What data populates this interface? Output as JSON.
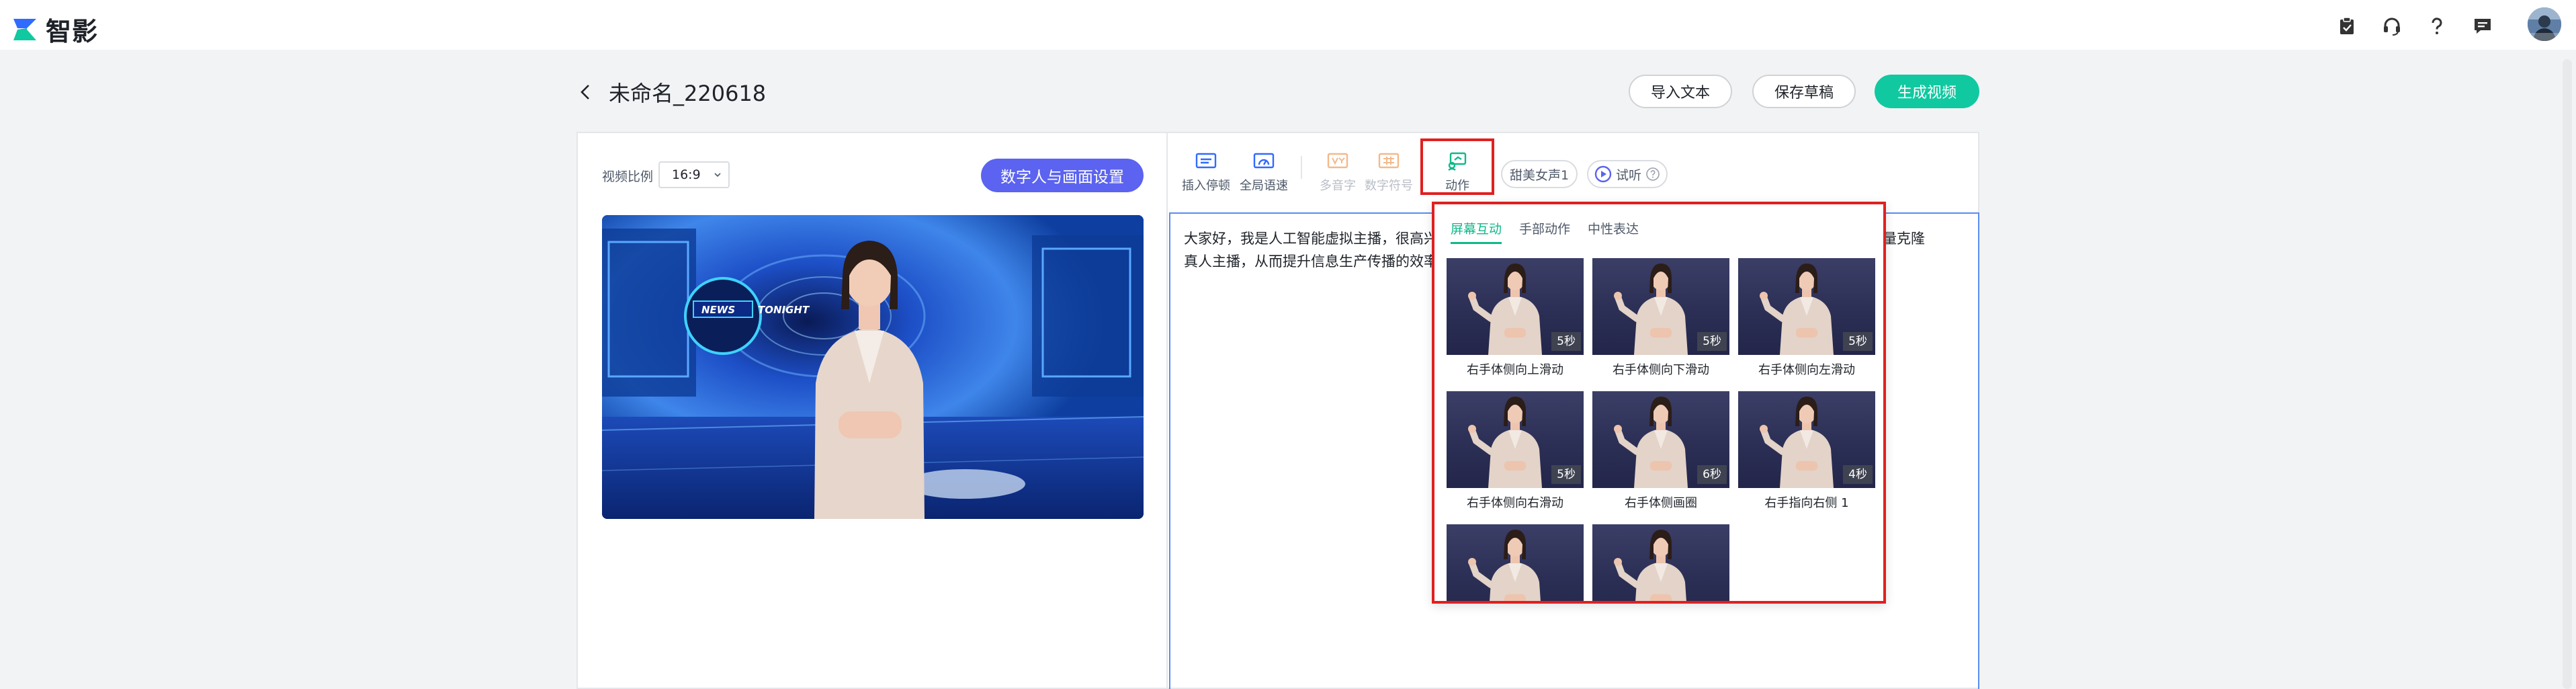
{
  "app": {
    "name": "智影",
    "brand_color": "#10c9a0"
  },
  "header": {
    "icons": [
      "clipboard-check-icon",
      "headset-icon",
      "help-icon",
      "message-icon"
    ],
    "avatar": "user-avatar"
  },
  "doc": {
    "title": "未命名_220618",
    "import_text_label": "导入文本",
    "save_draft_label": "保存草稿",
    "generate_video_label": "生成视频"
  },
  "left_pane": {
    "ratio_label": "视频比例",
    "ratio_value": "16:9",
    "avatar_settings_label": "数字人与画面设置",
    "preview_screen_text": {
      "news": "NEWS",
      "tonight": "TONIGHT"
    }
  },
  "toolbar": {
    "tools": [
      {
        "label": "插入停顿",
        "icon": "insert-pause-icon",
        "state": "enabled"
      },
      {
        "label": "全局语速",
        "icon": "speed-icon",
        "state": "enabled"
      },
      {
        "label": "多音字",
        "icon": "polyphone-icon",
        "state": "disabled"
      },
      {
        "label": "数字符号",
        "icon": "number-symbol-icon",
        "state": "disabled"
      },
      {
        "label": "动作",
        "icon": "action-icon",
        "state": "active"
      }
    ],
    "voice_label": "甜美女声1",
    "preview_listen_label": "试听"
  },
  "editor": {
    "line1": "大家好，我是人工智能虚拟主播，很高兴",
    "line1_end": "以批量克隆",
    "line2": "真人主播，从而提升信息生产传播的效率"
  },
  "actions_popup": {
    "tabs": [
      {
        "label": "屏幕互动",
        "active": true
      },
      {
        "label": "手部动作",
        "active": false
      },
      {
        "label": "中性表达",
        "active": false
      }
    ],
    "items": [
      {
        "label": "右手体侧向上滑动",
        "duration": "5秒"
      },
      {
        "label": "右手体侧向下滑动",
        "duration": "5秒"
      },
      {
        "label": "右手体侧向左滑动",
        "duration": "5秒"
      },
      {
        "label": "右手体侧向右滑动",
        "duration": "5秒"
      },
      {
        "label": "右手体侧画圈",
        "duration": "6秒"
      },
      {
        "label": "右手指向右侧 1",
        "duration": "4秒"
      },
      {
        "label": "",
        "duration": ""
      },
      {
        "label": "",
        "duration": ""
      }
    ]
  }
}
